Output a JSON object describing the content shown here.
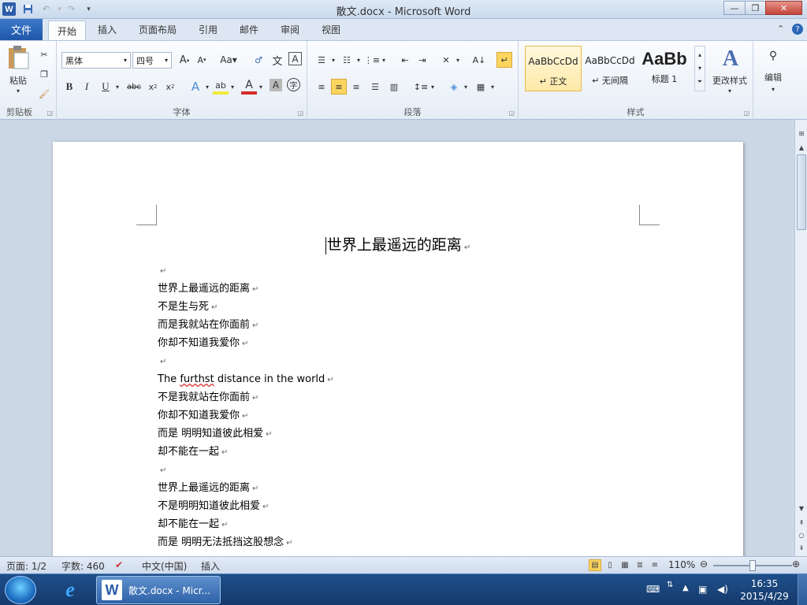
{
  "window": {
    "title": "散文.docx - Microsoft Word",
    "app_logo": "W"
  },
  "quick_access": {
    "save_icon": "save-icon",
    "undo_icon": "undo-icon",
    "redo_icon": "redo-icon",
    "customize_icon": "dropdown-icon"
  },
  "tabs": {
    "file": "文件",
    "items": [
      "开始",
      "插入",
      "页面布局",
      "引用",
      "邮件",
      "审阅",
      "视图"
    ],
    "active": "开始"
  },
  "ribbon": {
    "clipboard": {
      "paste_label": "粘贴",
      "group_label": "剪贴板"
    },
    "font": {
      "font_name": "黑体",
      "font_size": "四号",
      "group_label": "字体"
    },
    "paragraph": {
      "group_label": "段落"
    },
    "styles": {
      "cards": [
        {
          "preview": "AaBbCcDd",
          "name": "↵ 正文"
        },
        {
          "preview": "AaBbCcDd",
          "name": "↵ 无间隔"
        },
        {
          "preview": "AaBb",
          "name": "标题 1"
        }
      ],
      "change_styles_label": "更改样式",
      "group_label": "样式"
    },
    "editing": {
      "label": "编辑"
    }
  },
  "document": {
    "title": "世界上最遥远的距离",
    "lines": [
      "",
      "世界上最遥远的距离",
      "不是生与死",
      "而是我就站在你面前",
      "你却不知道我爱你",
      "",
      "The furthst distance in the world",
      "不是我就站在你面前",
      "你却不知道我爱你",
      "而是 明明知道彼此相爱",
      "却不能在一起",
      "",
      "世界上最遥远的距离",
      "不是明明知道彼此相爱",
      "却不能在一起",
      "而是 明明无法抵挡这股想念"
    ],
    "paragraph_mark": "↵"
  },
  "status_bar": {
    "page": "页面: 1/2",
    "word_count": "字数: 460",
    "language": "中文(中国)",
    "insert_mode": "插入",
    "zoom": "110%"
  },
  "taskbar": {
    "word_task_label": "散文.docx - Micr...",
    "time": "16:35",
    "date": "2015/4/29"
  }
}
